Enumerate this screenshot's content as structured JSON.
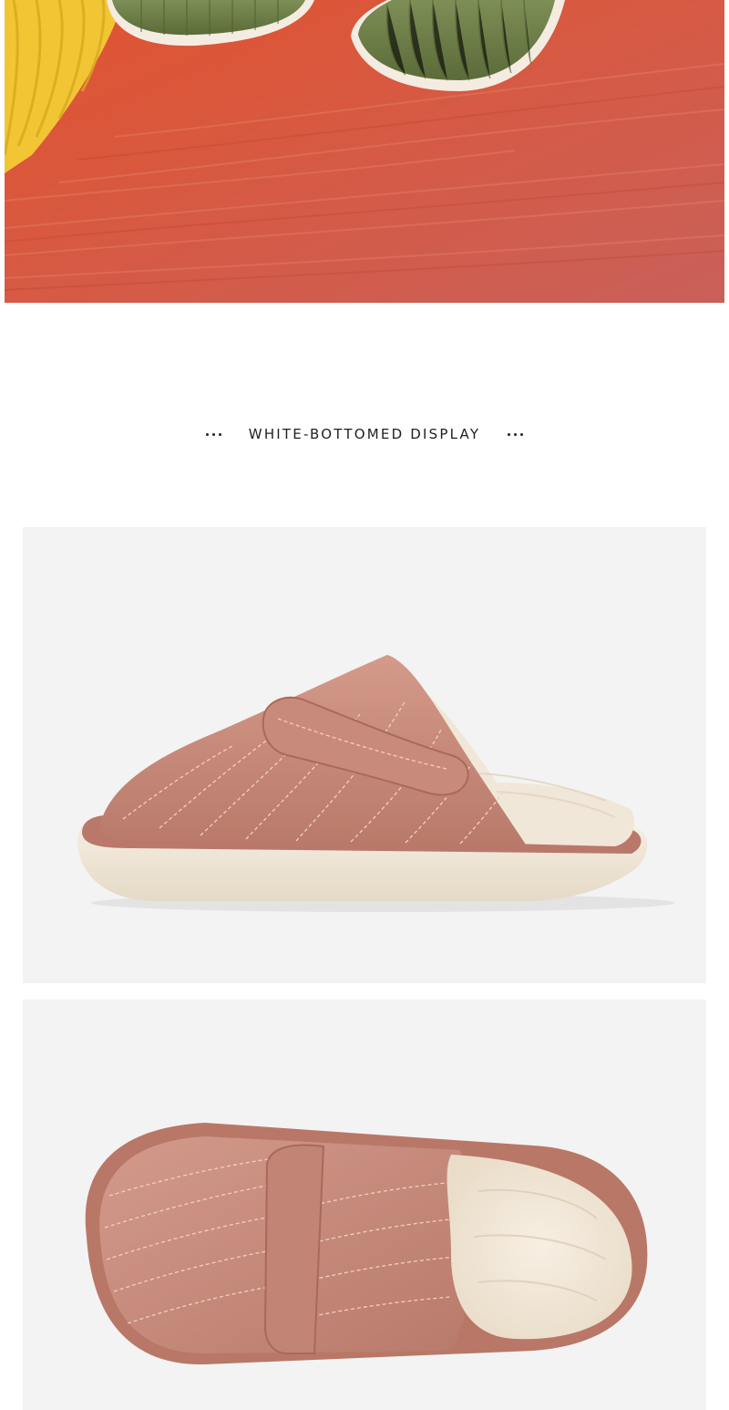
{
  "section": {
    "title": "WHITE-BOTTOMED DISPLAY"
  },
  "images": [
    {
      "name": "lifestyle-photo",
      "subject": "green-quilted-slippers-on-red-rug"
    },
    {
      "name": "product-side-view",
      "subject": "pink-quilted-slipper-side"
    },
    {
      "name": "product-top-view",
      "subject": "pink-quilted-slipper-top"
    }
  ],
  "colors": {
    "rug": "#d9553a",
    "slipper_green": "#6e7f4a",
    "slipper_pink": "#c68a7b",
    "plush_lining": "#f1e7d8",
    "sole": "#efe6d6",
    "panel_background": "#f3f3f3",
    "heading_text": "#1f1f1f"
  }
}
